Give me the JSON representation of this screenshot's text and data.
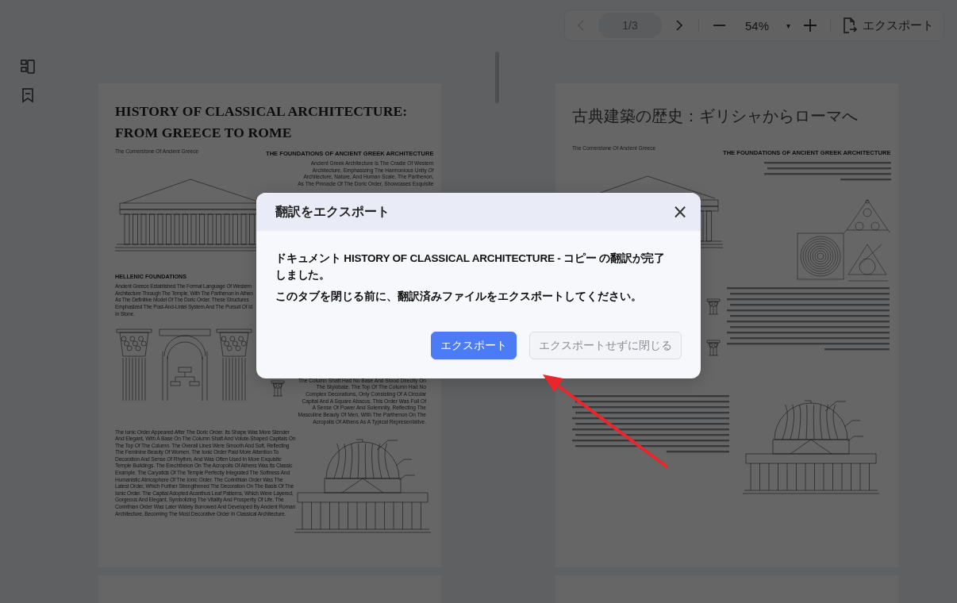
{
  "toolbar": {
    "prev_button": {
      "disabled": true
    },
    "page_field": {
      "value": "1/3"
    },
    "next_button": {
      "disabled": false
    },
    "zoom": {
      "value": "54%",
      "caret": "▾"
    },
    "export_button": {
      "label": "エクスポート"
    }
  },
  "pages": [
    {
      "kind": "original",
      "title_lines": [
        "HISTORY OF CLASSICAL  ARCHITECTURE:",
        "FROM GREECE TO ROME"
      ],
      "subtitle": "The Cornerstone Of Ancient Greece",
      "heading": "THE FOUNDATIONS OF ANCIENT GREEK ARCHITECTURE",
      "intro_lines": [
        "Ancient Greek Architecture Is The Cradle Of Western",
        "Architecture, Emphasizing The Harmonious Unity Of",
        "Architecture, Nature, And Human Scale. The Parthenon,",
        "As The Pinnacle Of The Doric Order, Showcases Exquisite"
      ],
      "section_heading": "HELLENIC FOUNDATIONS",
      "section_lines": [
        "Ancient Greece Established The Formal Language Of Western",
        "Architecture Through The Temple, With The Parthenon In Athen",
        "As The Definitive Model Of The Doric Order. These Structures",
        "Emphasized The Post-And-Lintel System And The Pursuit Of Id",
        "In Stone."
      ],
      "doric_lines": [
        "The Column Shaft Had No Base And Stood Directly On",
        "The Stylobate. The Top Of The Column Had No",
        "Complex Decorations, Only Consisting Of A Circular",
        "Capital And A Square Abacus. This Order Was Full Of",
        "A Sense Of Power And Solemnity, Reflecting The",
        "Masculine Beauty Of Men, With The Parthenon On The",
        "Acropolis Of Athens As A Typical Representative."
      ],
      "ionic_text": "The Ionic Order Appeared After The Doric Order. Its Shape Was More Slender And Elegant, With A Base On The Column Shaft And Volute-Shaped Capitals On The Top Of The Column. The Overall Lines Were Smooth And Soft, Reflecting The Feminine Beauty Of Women. The Ionic Order Paid More Attention To Decoration And Sense Of Rhythm, And Was Often Used In More Exquisite Temple Buildings. The Erechtheion On The Acropolis Of Athens Was Its Classic Example. The Caryatids Of The Temple Perfectly Integrated The Softness And Humanistic Atmosphere Of The Ionic Order. The Corinthian Order Was The Latest Order, Which Further Strengthened The Decoration On The Basis Of The Ionic Order. The Capital Adopted Acanthus Leaf Patterns, Which Were Layered, Gorgeous And Elegant, Symbolizing The Vitality And Prosperity Of Life. The Corinthian Order Was Later Widely Borrowed And Developed By Ancient Roman Architecture, Becoming The Most Decorative Order In Classical Architecture."
    },
    {
      "kind": "translated",
      "title": "古典建築の歴史：ギリシャからローマへ",
      "subtitle": "The Cornerstone Of Ancient Greece",
      "heading": "THE FOUNDATIONS OF ANCIENT GREEK ARCHITECTURE"
    }
  ],
  "dialog": {
    "title": "翻訳をエクスポート",
    "close": "×",
    "message": "ドキュメント HISTORY OF CLASSICAL ARCHITECTURE - コピー の翻訳が完了しました。",
    "note": "このタブを閉じる前に、翻訳済みファイルをエクスポートしてください。",
    "buttons": [
      {
        "label": "エクスポート",
        "kind": "primary"
      },
      {
        "label": "エクスポートせずに閉じる",
        "kind": "secondary"
      }
    ]
  }
}
